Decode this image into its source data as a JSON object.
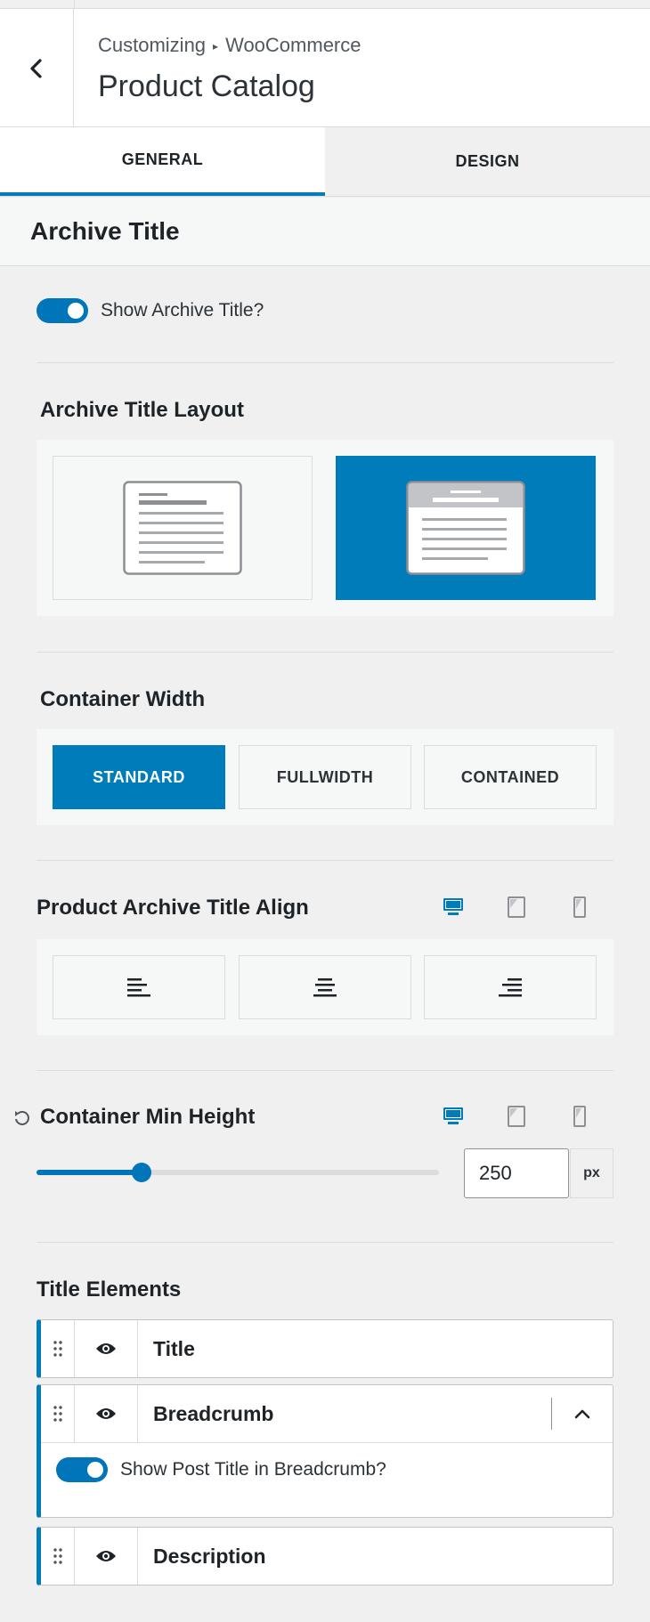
{
  "header": {
    "breadcrumb_parent": "Customizing",
    "breadcrumb_separator": "▸",
    "breadcrumb_section": "WooCommerce",
    "title": "Product Catalog"
  },
  "tabs": [
    {
      "label": "GENERAL",
      "active": true
    },
    {
      "label": "DESIGN",
      "active": false
    }
  ],
  "section": {
    "title": "Archive Title"
  },
  "show_archive_title": {
    "label": "Show Archive Title?",
    "enabled": true
  },
  "archive_title_layout": {
    "label": "Archive Title Layout",
    "options": [
      {
        "name": "normal",
        "selected": false
      },
      {
        "name": "above",
        "selected": true
      }
    ]
  },
  "container_width": {
    "label": "Container Width",
    "options": [
      "STANDARD",
      "FULLWIDTH",
      "CONTAINED"
    ],
    "selected": "STANDARD"
  },
  "title_align": {
    "label": "Product Archive Title Align",
    "options": [
      "left",
      "center",
      "right"
    ]
  },
  "min_height": {
    "label": "Container Min Height",
    "value": "250",
    "unit": "px",
    "slider_fraction": 0.26
  },
  "title_elements": {
    "label": "Title Elements",
    "items": [
      {
        "name": "Title"
      },
      {
        "name": "Breadcrumb",
        "expanded": true,
        "option_label": "Show Post Title in Breadcrumb?"
      },
      {
        "name": "Description"
      }
    ]
  },
  "colors": {
    "accent": "#007cba",
    "toggle": "#0075b9",
    "background": "#f0f0f1"
  }
}
